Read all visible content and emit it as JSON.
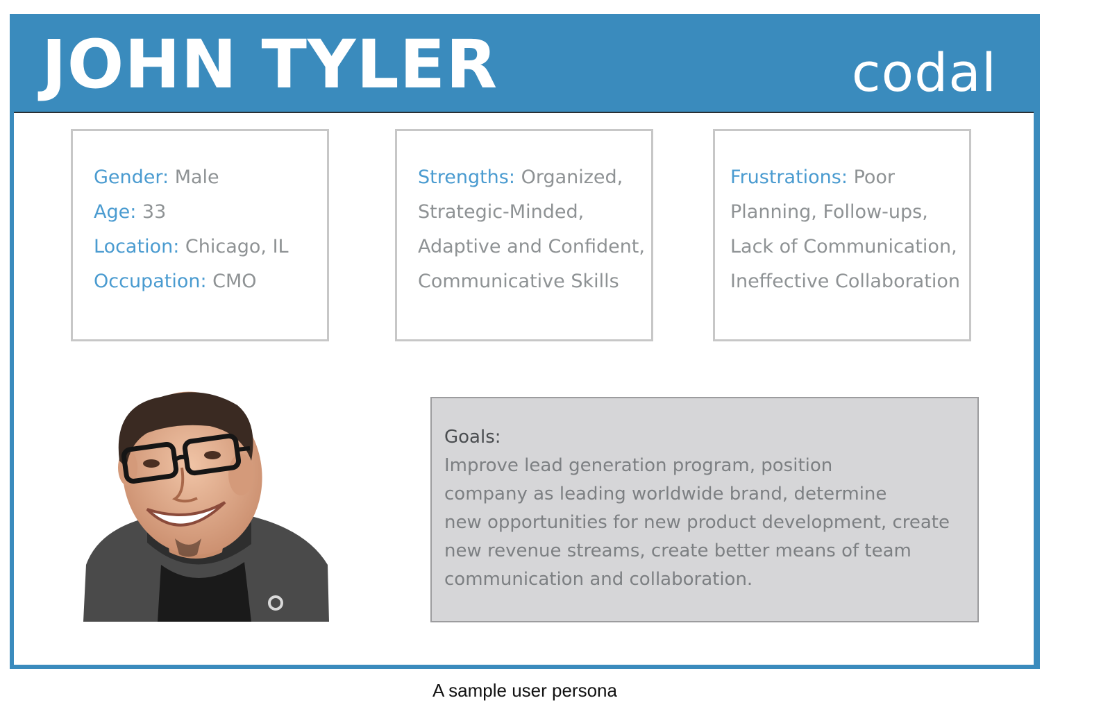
{
  "header": {
    "name": "JOHN TYLER",
    "brand": "codal"
  },
  "demographics": {
    "gender_label": "Gender:",
    "gender_value": "Male",
    "age_label": "Age:",
    "age_value": "33",
    "location_label": "Location:",
    "location_value": "Chicago, IL",
    "occupation_label": "Occupation:",
    "occupation_value": "CMO"
  },
  "strengths": {
    "label": "Strengths:",
    "line1": "Organized,",
    "line2": "Strategic-Minded,",
    "line3": "Adaptive and Confident,",
    "line4": "Communicative Skills"
  },
  "frustrations": {
    "label": "Frustrations:",
    "line1": "Poor",
    "line2": "Planning, Follow-ups,",
    "line3": "Lack of Communication,",
    "line4": "Ineffective Collaboration"
  },
  "goals": {
    "title": "Goals:",
    "body": "Improve lead generation program, position\ncompany as leading worldwide brand, determine\nnew opportunities for new product development, create\nnew revenue streams, create better means of team\ncommunication and collaboration."
  },
  "caption": "A sample user persona",
  "colors": {
    "brand_blue": "#3a8bbd",
    "label_blue": "#4a9bd0",
    "goals_bg": "#d6d6d8"
  }
}
